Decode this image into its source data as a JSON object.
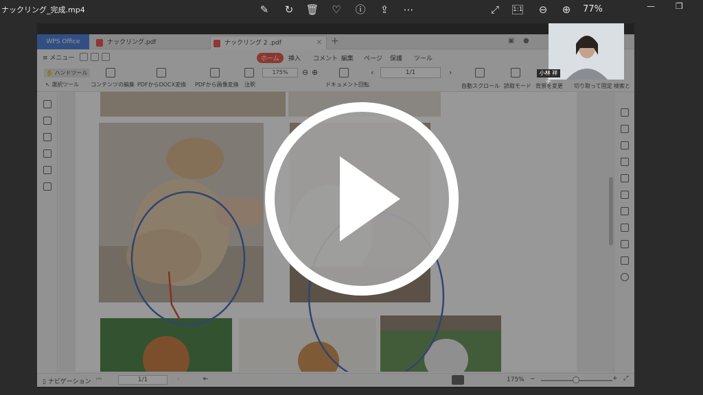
{
  "player": {
    "title": "ナックリング_完成.mp4",
    "zoom": "77%",
    "icons": [
      "edit-icon",
      "rotate-icon",
      "trash-icon",
      "heart-icon",
      "info-icon",
      "share-icon",
      "more-icon",
      "fullscreen-icon",
      "actual-size-icon",
      "zoom-out-icon",
      "zoom-in-icon"
    ]
  },
  "app": {
    "tabs": {
      "wps": "WPS Office",
      "tab1": "ナックリング.pdf",
      "tab2": "ナックリング 2 .pdf"
    },
    "menu": {
      "main": "メニュー",
      "tabs": [
        "ホーム",
        "挿入",
        "コメント",
        "編集",
        "ページ",
        "保護",
        "ツール"
      ],
      "active": "ホーム"
    },
    "ribbon": {
      "hand_tool": "ハンドツール",
      "select_tool": "選択ツール",
      "content_edit": "コンテンツの編集",
      "pdf_to_docx": "PDFからDOCX変換",
      "pdf_to_image": "PDFから画像変換",
      "annotate": "注釈",
      "zoom": "175%",
      "doc_rotate": "ドキュメント回転",
      "page": "1/1",
      "auto_scroll": "自動スクロール",
      "read_mode": "読取モード",
      "bg_change": "背景を変更",
      "crop_fix": "切り取って固定",
      "search": "検索と"
    },
    "status": {
      "navigation": "ナビゲーション",
      "page": "1/1",
      "zoom": "175%"
    }
  },
  "webcam": {
    "label": "小林 祥子"
  },
  "colors": {
    "accent": "#e8463a",
    "wps_blue": "#3b73d6",
    "annotation_blue": "#3a5fb0",
    "annotation_red": "#d63a2a"
  }
}
